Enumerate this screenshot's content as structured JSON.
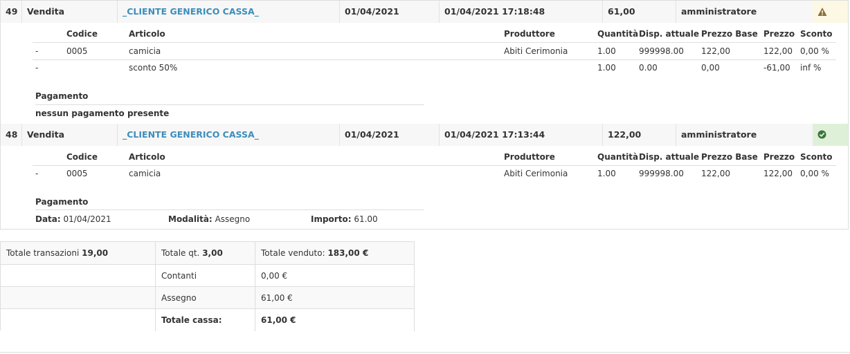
{
  "sales": [
    {
      "id": "49",
      "type": "Vendita",
      "customer": "_CLIENTE GENERICO CASSA_",
      "date": "01/04/2021",
      "datetime": "01/04/2021 17:18:48",
      "total": "61,00",
      "user": "amministratore",
      "status_icon": "warning-triangle-icon",
      "status_color": "#8a6d3b",
      "items_headers": [
        "Codice",
        "Articolo",
        "Produttore",
        "Quantità",
        "Disp. attuale",
        "Prezzo Base",
        "Prezzo",
        "Sconto"
      ],
      "items": [
        {
          "dash": "-",
          "code": "0005",
          "article": "camicia",
          "producer": "Abiti Cerimonia",
          "qty": "1.00",
          "avail": "999998.00",
          "base": "122,00",
          "price": "122,00",
          "discount": "0,00 %"
        },
        {
          "dash": "-",
          "code": "",
          "article": "sconto 50%",
          "producer": "",
          "qty": "1.00",
          "avail": "0.00",
          "base": "0,00",
          "price": "-61,00",
          "discount": "inf %"
        }
      ],
      "payment_title": "Pagamento",
      "payment_none": "nessun pagamento presente"
    },
    {
      "id": "48",
      "type": "Vendita",
      "customer": "_CLIENTE GENERICO CASSA_",
      "date": "01/04/2021",
      "datetime": "01/04/2021 17:13:44",
      "total": "122,00",
      "user": "amministratore",
      "status_icon": "check-circle-icon",
      "status_color": "#3c763d",
      "items_headers": [
        "Codice",
        "Articolo",
        "Produttore",
        "Quantità",
        "Disp. attuale",
        "Prezzo Base",
        "Prezzo",
        "Sconto"
      ],
      "items": [
        {
          "dash": "-",
          "code": "0005",
          "article": "camicia",
          "producer": "Abiti Cerimonia",
          "qty": "1.00",
          "avail": "999998.00",
          "base": "122,00",
          "price": "122,00",
          "discount": "0,00 %"
        }
      ],
      "payment_title": "Pagamento",
      "payment": {
        "date_label": "Data:",
        "date_value": "01/04/2021",
        "mode_label": "Modalità:",
        "mode_value": "Assegno",
        "amount_label": "Importo:",
        "amount_value": "61.00"
      }
    }
  ],
  "totals": {
    "transactions_label": "Totale transazioni",
    "transactions_value": "19,00",
    "qty_label": "Totale qt.",
    "qty_value": "3,00",
    "sold_label": "Totale venduto:",
    "sold_value": "183,00 €",
    "rows": [
      {
        "label": "Contanti",
        "value": "0,00 €",
        "bold": false
      },
      {
        "label": "Assegno",
        "value": "61,00 €",
        "bold": false
      },
      {
        "label": "Totale cassa:",
        "value": "61,00 €",
        "bold": true
      }
    ]
  }
}
